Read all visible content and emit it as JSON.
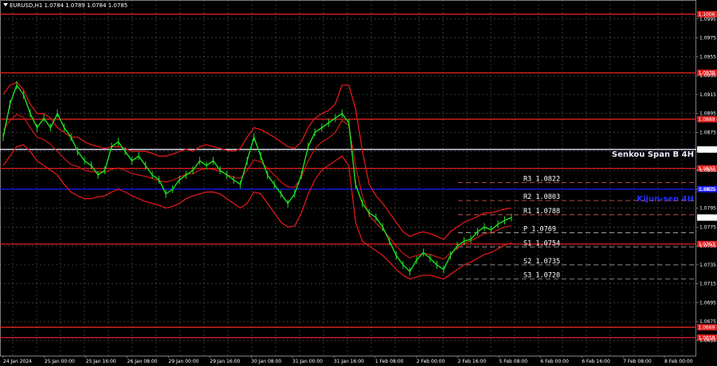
{
  "chart_data": {
    "type": "line",
    "symbol": "EURUSD,H1",
    "title": "EURUSD,H1  1.0784 1.0789 1.0784 1.0785",
    "ylim": [
      1.0639,
      1.1015
    ],
    "y_ticks": [
      "1.0995",
      "1.0975",
      "1.0955",
      "1.0935",
      "1.0915",
      "1.0895",
      "1.0875",
      "1.0855",
      "1.0835",
      "1.0815",
      "1.0795",
      "1.0775",
      "1.0755",
      "1.0735",
      "1.0715",
      "1.0695",
      "1.0675",
      "1.0655"
    ],
    "x_ticks": [
      "24 Jan 2024",
      "25 Jan 00:00",
      "25 Jan 16:00",
      "26 Jan 08:00",
      "29 Jan 00:00",
      "29 Jan 16:00",
      "30 Jan 08:00",
      "31 Jan 00:00",
      "31 Jan 16:00",
      "1 Feb 08:00",
      "2 Feb 00:00",
      "2 Feb 16:00",
      "5 Feb 08:00",
      "6 Feb 00:00",
      "6 Feb 16:00",
      "7 Feb 08:00",
      "8 Feb 00:00"
    ],
    "last_price": "1.0785",
    "horizontal_levels": [
      {
        "value": 1.1,
        "label": "1.1006",
        "color": "#e02020",
        "style": "solid"
      },
      {
        "value": 1.0938,
        "label": "1.0938",
        "color": "#e02020",
        "style": "solid"
      },
      {
        "value": 1.0889,
        "label": "1.0889",
        "color": "#e02020",
        "style": "solid"
      },
      {
        "value": 1.0857,
        "label": "1.0857",
        "color": "#e8e8ff",
        "style": "solid",
        "name": "Senkou Span B 4H"
      },
      {
        "value": 1.0837,
        "label": "1.0837",
        "color": "#e02020",
        "style": "solid"
      },
      {
        "value": 1.0815,
        "label": "1.0815",
        "color": "#1a1aff",
        "style": "solid",
        "name": "Kijun-sen 4H"
      },
      {
        "value": 1.0757,
        "label": "1.0757",
        "color": "#e02020",
        "style": "solid"
      },
      {
        "value": 1.0669,
        "label": "1.0669",
        "color": "#e02020",
        "style": "solid"
      },
      {
        "value": 1.0658,
        "label": "1.0658",
        "color": "#e02020",
        "style": "solid"
      }
    ],
    "pivots": [
      {
        "name": "R3",
        "value": 1.0822,
        "label": "R3 1.0822",
        "color": "#d05050",
        "style": "dashed"
      },
      {
        "name": "R2",
        "value": 1.0803,
        "label": "R2 1.0803",
        "color": "#d05050",
        "style": "dashed"
      },
      {
        "name": "R1",
        "value": 1.0788,
        "label": "R1 1.0788",
        "color": "#d05050",
        "style": "dashed"
      },
      {
        "name": "P",
        "value": 1.0769,
        "label": "P 1.0769",
        "color": "#b0b0b0",
        "style": "dashed"
      },
      {
        "name": "S1",
        "value": 1.0754,
        "label": "S1 1.0754",
        "color": "#909090",
        "style": "dashed"
      },
      {
        "name": "S2",
        "value": 1.0735,
        "label": "S2 1.0735",
        "color": "#909090",
        "style": "dashed"
      },
      {
        "name": "S3",
        "value": 1.072,
        "label": "S3 1.0720",
        "color": "#909090",
        "style": "dashed"
      }
    ],
    "price_series": [
      1.087,
      1.0905,
      1.0925,
      1.0915,
      1.0895,
      1.088,
      1.089,
      1.088,
      1.0895,
      1.088,
      1.087,
      1.0855,
      1.0845,
      1.084,
      1.083,
      1.0835,
      1.086,
      1.0865,
      1.0855,
      1.0845,
      1.085,
      1.084,
      1.083,
      1.0825,
      1.081,
      1.0815,
      1.0825,
      1.083,
      1.0835,
      1.0845,
      1.084,
      1.0845,
      1.0835,
      1.083,
      1.0825,
      1.082,
      1.0845,
      1.087,
      1.085,
      1.083,
      1.082,
      1.081,
      1.08,
      1.081,
      1.083,
      1.086,
      1.0875,
      1.088,
      1.0885,
      1.089,
      1.0895,
      1.0885,
      1.082,
      1.08,
      1.079,
      1.0785,
      1.0775,
      1.076,
      1.0745,
      1.0735,
      1.0728,
      1.074,
      1.0748,
      1.0742,
      1.0735,
      1.073,
      1.0745,
      1.0755,
      1.076,
      1.0762,
      1.077,
      1.0775,
      1.0772,
      1.0778,
      1.0782,
      1.0785
    ],
    "band_upper": [
      1.0915,
      1.0925,
      1.0928,
      1.092,
      1.0905,
      1.0895,
      1.0895,
      1.089,
      1.088,
      1.0875,
      1.087,
      1.087,
      1.0865,
      1.0862,
      1.086,
      1.0858,
      1.086,
      1.086,
      1.0858,
      1.0855,
      1.0855,
      1.0855,
      1.0853,
      1.085,
      1.085,
      1.0852,
      1.0855,
      1.0857,
      1.0855,
      1.086,
      1.0862,
      1.086,
      1.0858,
      1.0856,
      1.0855,
      1.0858,
      1.087,
      1.088,
      1.0878,
      1.0874,
      1.087,
      1.0865,
      1.086,
      1.0858,
      1.0865,
      1.088,
      1.089,
      1.0895,
      1.0898,
      1.0905,
      1.0925,
      1.0925,
      1.09,
      1.0855,
      1.082,
      1.0808,
      1.08,
      1.079,
      1.078,
      1.077,
      1.0765,
      1.0768,
      1.077,
      1.0768,
      1.0765,
      1.0762,
      1.077,
      1.0775,
      1.078,
      1.0783,
      1.0786,
      1.079,
      1.079,
      1.0792,
      1.0794,
      1.0795
    ],
    "band_lower": [
      1.084,
      1.085,
      1.086,
      1.0862,
      1.0855,
      1.0845,
      1.084,
      1.0835,
      1.083,
      1.082,
      1.0812,
      1.0808,
      1.0805,
      1.0805,
      1.0807,
      1.0808,
      1.0812,
      1.0815,
      1.0812,
      1.0808,
      1.0805,
      1.0802,
      1.08,
      1.0798,
      1.0795,
      1.0797,
      1.08,
      1.0805,
      1.0808,
      1.081,
      1.0812,
      1.0812,
      1.081,
      1.0805,
      1.08,
      1.0795,
      1.08,
      1.0812,
      1.081,
      1.08,
      1.079,
      1.078,
      1.0775,
      1.0776,
      1.079,
      1.081,
      1.0825,
      1.0835,
      1.084,
      1.0845,
      1.085,
      1.084,
      1.078,
      1.076,
      1.0755,
      1.075,
      1.0745,
      1.0738,
      1.073,
      1.0724,
      1.072,
      1.0722,
      1.0724,
      1.0724,
      1.0722,
      1.072,
      1.0725,
      1.073,
      1.0735,
      1.0738,
      1.0742,
      1.0746,
      1.0748,
      1.0752,
      1.0756,
      1.0758
    ]
  }
}
